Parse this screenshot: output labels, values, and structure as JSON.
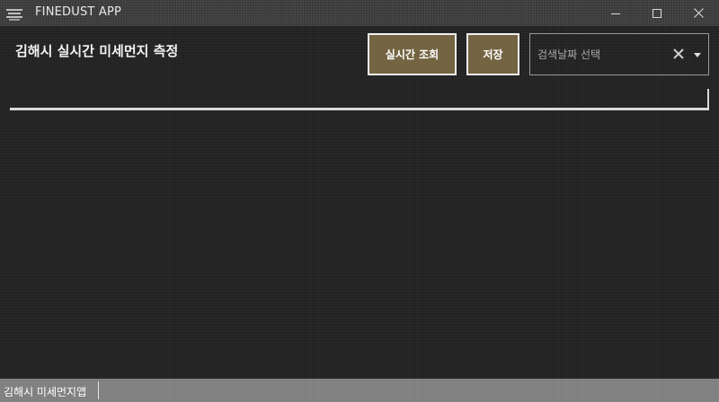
{
  "window": {
    "title": "FINEDUST APP",
    "icons": {
      "app": "app-menu-icon",
      "minimize": "minimize-icon",
      "maximize": "maximize-icon",
      "close": "close-icon"
    }
  },
  "header": {
    "title": "김해시 실시간 미세먼지 측정"
  },
  "toolbar": {
    "realtime_label": "실시간 조회",
    "save_label": "저장",
    "date_placeholder": "검색날짜 선택",
    "date_value": ""
  },
  "statusbar": {
    "text": "김해시 미세먼지앱"
  },
  "colors": {
    "button_bg": "#746442",
    "content_bg": "#222222",
    "accent_line": "#d9d9d9"
  }
}
